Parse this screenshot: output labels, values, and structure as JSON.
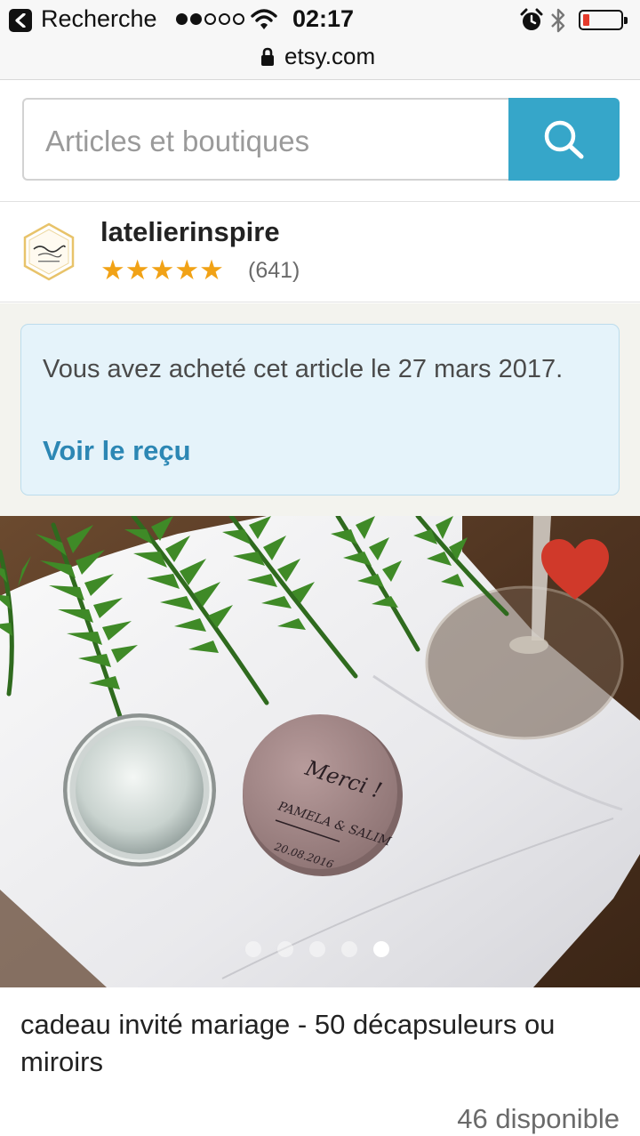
{
  "status_bar": {
    "back_label": "Recherche",
    "time": "02:17",
    "signal_bars": 2,
    "battery_level": 0.1
  },
  "browser": {
    "url": "etsy.com"
  },
  "search": {
    "placeholder": "Articles et boutiques",
    "button_icon": "search-icon",
    "accent_color": "#36a6c9"
  },
  "shop": {
    "name": "latelierinspire",
    "rating": 5,
    "stars": "★★★★★",
    "reviews_count": "(641)",
    "logo_text": "Latelier inspiré"
  },
  "purchase_notice": {
    "message": "Vous avez acheté cet article le 27 mars 2017.",
    "receipt_link": "Voir le reçu"
  },
  "product": {
    "image_lettering": [
      "Merci !",
      "PAMELA & SALIM",
      "20.08.2016"
    ],
    "favorite_icon": "heart-icon",
    "gallery_count": 5,
    "gallery_active": 5,
    "title": "cadeau invité mariage - 50 décapsuleurs ou miroirs",
    "availability": "46 disponible"
  }
}
